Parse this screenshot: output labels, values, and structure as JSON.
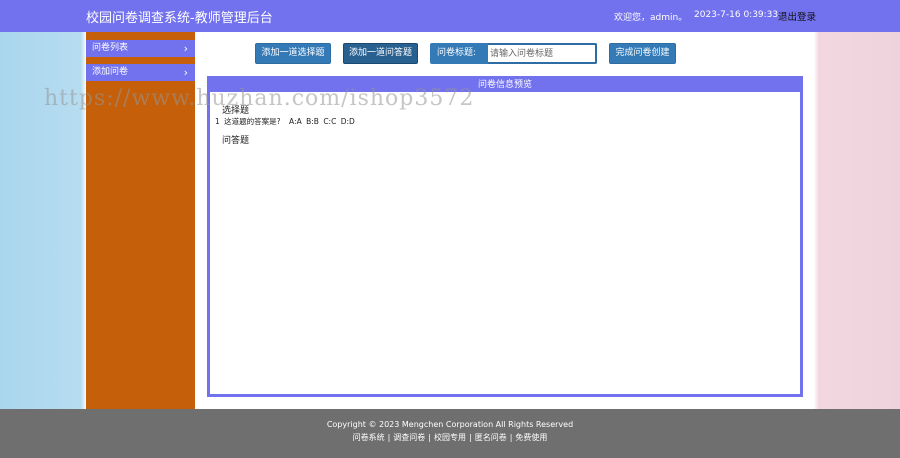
{
  "header": {
    "title": "校园问卷调查系统-教师管理后台",
    "welcome": "欢迎您，admin。",
    "time": "2023-7-16 0:39:33",
    "logout": "退出登录"
  },
  "sidebar": {
    "items": [
      {
        "label": "问卷列表",
        "chevron": "›"
      },
      {
        "label": "添加问卷",
        "chevron": "›"
      }
    ]
  },
  "toolbar": {
    "add_choice": "添加一道选择题",
    "add_qa": "添加一道问答题",
    "title_label": "问卷标题:",
    "title_placeholder": "请输入问卷标题",
    "title_value": "",
    "finish": "完成问卷创建"
  },
  "preview": {
    "header": "问卷信息预览",
    "choice_section": "选择题",
    "question": {
      "number": "1",
      "text": "这道题的答案是?",
      "options": [
        "A:A",
        "B:B",
        "C:C",
        "D:D"
      ]
    },
    "qa_section": "问答题"
  },
  "watermark": "https://www.huzhan.com/ishop3572",
  "footer": {
    "copyright": "Copyright © 2023 Mengchen Corporation All Rights Reserved",
    "links": [
      "问卷系统",
      "调查问卷",
      "校园专用",
      "匿名问卷",
      "免费使用"
    ],
    "separator": "|"
  },
  "colors": {
    "header_bg": "#7271ee",
    "sidebar_bg": "#c55f09",
    "button_bg": "#337ab7",
    "footer_bg": "#6f6f6f"
  }
}
